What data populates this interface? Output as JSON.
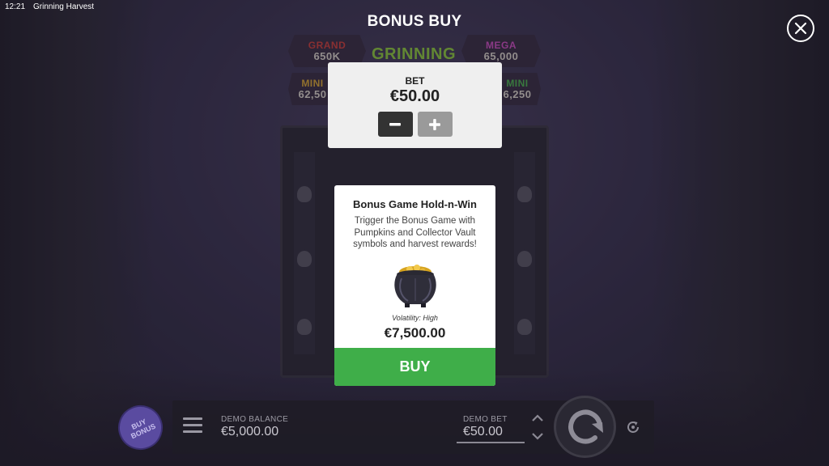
{
  "statusbar": {
    "time": "12:21",
    "app_title": "Grinning Harvest"
  },
  "jackpots": [
    {
      "label": "GRAND",
      "value": "650K",
      "color": "#c8403c"
    },
    {
      "label": "GRINNING",
      "value": "",
      "color": "#8cc63f"
    },
    {
      "label": "MEGA",
      "value": "65,000",
      "color": "#c94fbf"
    },
    {
      "label": "MINI",
      "value": "62,50",
      "color": "#d4a437"
    },
    {
      "label": "MINI",
      "value": "6,250",
      "color": "#4caf50"
    }
  ],
  "modal": {
    "title": "BONUS BUY"
  },
  "bet_panel": {
    "label": "BET",
    "value": "€50.00"
  },
  "bonus_card": {
    "title": "Bonus Game Hold-n-Win",
    "description": "Trigger the Bonus Game with Pumpkins and Collector Vault symbols and harvest rewards!",
    "volatility": "Volatility: High",
    "price": "€7,500.00",
    "buy_label": "BUY"
  },
  "bottom_bar": {
    "buy_bonus_label": "BUY BONUS",
    "balance_label": "DEMO BALANCE",
    "balance_value": "€5,000.00",
    "bet_label": "DEMO BET",
    "bet_value": "€50.00"
  },
  "colors": {
    "buy_green": "#3fae49",
    "panel_bg": "#efefef",
    "buy_bonus_purple": "#5a4ba0"
  }
}
